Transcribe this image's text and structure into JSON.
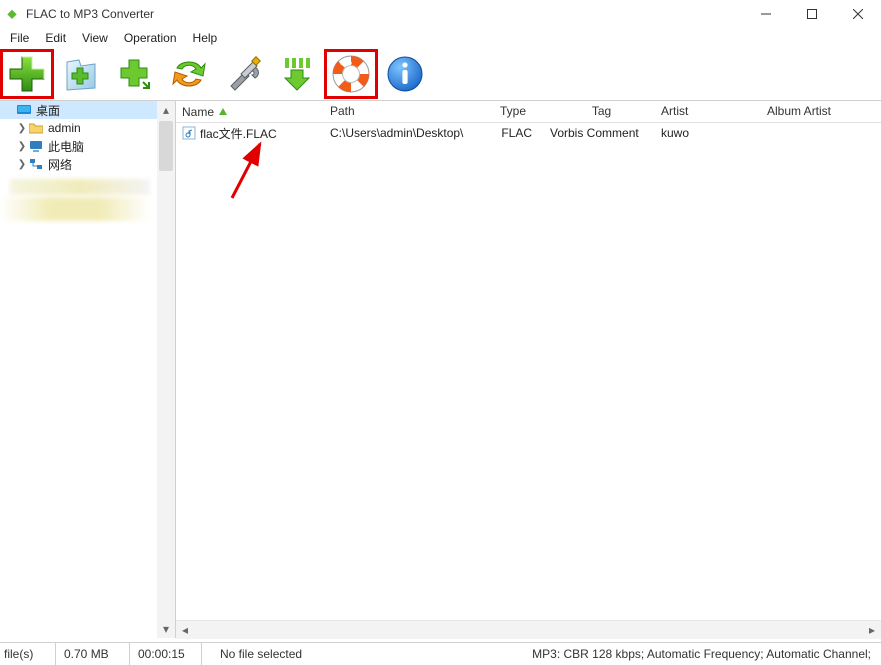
{
  "app": {
    "title": "FLAC to MP3 Converter"
  },
  "menu": {
    "items": [
      "File",
      "Edit",
      "View",
      "Operation",
      "Help"
    ]
  },
  "toolbar": {
    "items": [
      {
        "name": "add-button",
        "icon": "plus"
      },
      {
        "name": "add-folder-button",
        "icon": "folder-plus"
      },
      {
        "name": "add-sub-button",
        "icon": "plus-down"
      },
      {
        "name": "convert-button",
        "icon": "cycle"
      },
      {
        "name": "settings-button",
        "icon": "tools"
      },
      {
        "name": "download-button",
        "icon": "download"
      },
      {
        "name": "help-button",
        "icon": "lifebuoy"
      },
      {
        "name": "about-button",
        "icon": "info"
      }
    ]
  },
  "tree": {
    "items": [
      {
        "label": "桌面",
        "icon": "desktop",
        "selected": true,
        "expandable": false,
        "indent": 0
      },
      {
        "label": "admin",
        "icon": "folder",
        "selected": false,
        "expandable": true,
        "indent": 1
      },
      {
        "label": "此电脑",
        "icon": "pc",
        "selected": false,
        "expandable": true,
        "indent": 1
      },
      {
        "label": "网络",
        "icon": "network",
        "selected": false,
        "expandable": true,
        "indent": 1
      }
    ]
  },
  "list": {
    "columns": {
      "name": "Name",
      "path": "Path",
      "type": "Type",
      "tag": "Tag",
      "artist": "Artist",
      "albumartist": "Album Artist"
    },
    "rows": [
      {
        "name": "flac文件.FLAC",
        "path": "C:\\Users\\admin\\Desktop\\",
        "type": "FLAC",
        "tag": "Vorbis Comment",
        "artist": "kuwo",
        "albumartist": ""
      }
    ]
  },
  "status": {
    "files": "file(s)",
    "size": "0.70 MB",
    "duration": "00:00:15",
    "selection": "No file selected",
    "format": "MP3:  CBR 128 kbps; Automatic Frequency; Automatic Channel;"
  }
}
